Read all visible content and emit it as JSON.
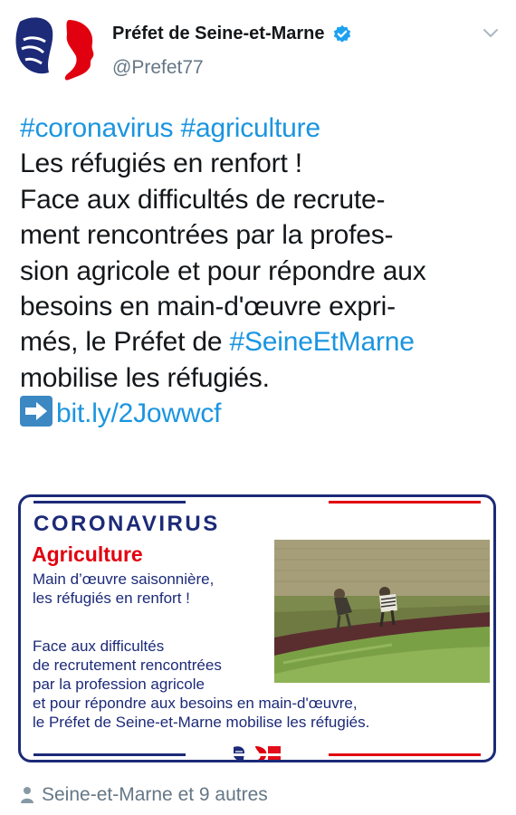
{
  "account": {
    "name": "Préfet de Seine-et-Marne",
    "handle": "@Prefet77"
  },
  "tweet": {
    "hashtag1": "#coronavirus",
    "hashtag2": "#agriculture",
    "line2": "Les réfugiés en renfort !",
    "line3": "Face aux difficultés de recrute-",
    "line4": "ment rencontrées par la profes-",
    "line5": "sion agricole et pour répondre aux",
    "line6": "besoins en main-d'œuvre expri-",
    "line7_pre": "més, le Préfet de ",
    "line7_tag": "#SeineEtMarne",
    "line8": "mobilise les réfugiés.",
    "link": "bit.ly/2Jowwcf"
  },
  "card": {
    "title": "CORONAVIRUS",
    "subtitle": "Agriculture",
    "lead1": "Main d’œuvre saisonnière,",
    "lead2": "les réfugiés en renfort !",
    "body1": "Face aux difficultés",
    "body2": "de recrutement rencontrées",
    "body3": "par la profession agricole",
    "body4": "et pour répondre aux besoins en main-d'œuvre,",
    "body5": "le Préfet de Seine-et-Marne mobilise les réfugiés."
  },
  "footer": {
    "location": "Seine-et-Marne et 9 autres"
  },
  "colors": {
    "link": "#1b95e0",
    "navy": "#1c2a78",
    "red": "#e1000f",
    "muted": "#657786"
  }
}
